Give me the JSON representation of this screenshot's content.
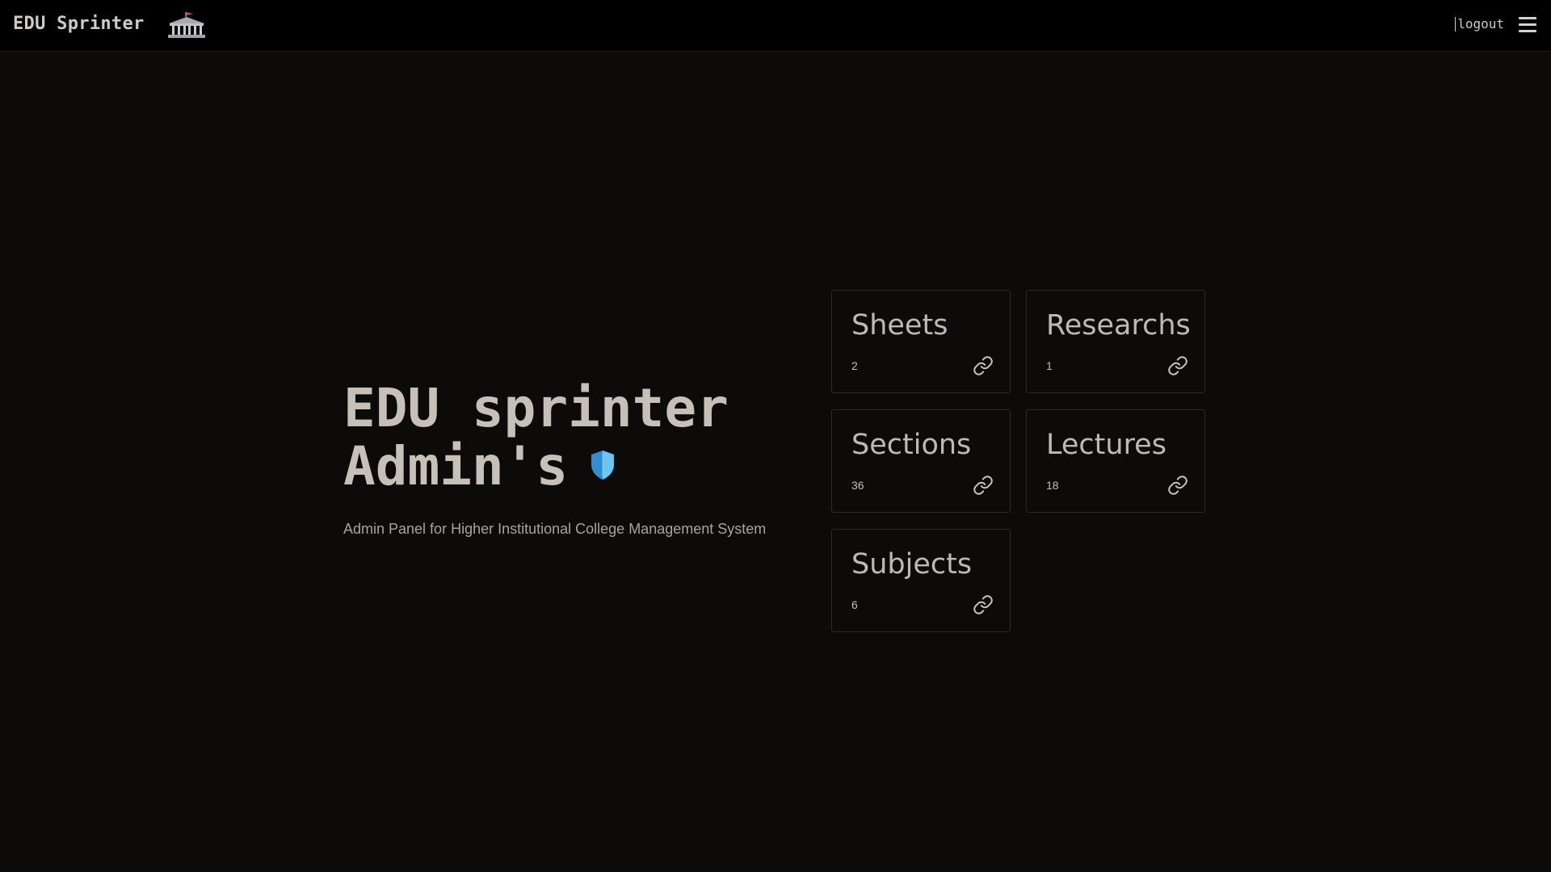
{
  "header": {
    "brand": "EDU Sprinter",
    "brand_icon": "classical-building-icon",
    "logout_label": "logout",
    "menu_icon": "hamburger-menu-icon"
  },
  "hero": {
    "title_line1": "EDU sprinter",
    "title_line2": "Admin's",
    "badge_icon": "shield-icon",
    "subtitle": "Admin Panel for Higher Institutional College Management System"
  },
  "cards": [
    {
      "title": "Sheets",
      "count": "2",
      "icon": "link-icon"
    },
    {
      "title": "Researchs",
      "count": "1",
      "icon": "link-icon"
    },
    {
      "title": "Sections",
      "count": "36",
      "icon": "link-icon"
    },
    {
      "title": "Lectures",
      "count": "18",
      "icon": "link-icon"
    },
    {
      "title": "Subjects",
      "count": "6",
      "icon": "link-icon"
    }
  ],
  "colors": {
    "background": "#0c0b0a",
    "topbar": "#000000",
    "text": "#c6c0b8",
    "shield": "#3aa8e0"
  }
}
